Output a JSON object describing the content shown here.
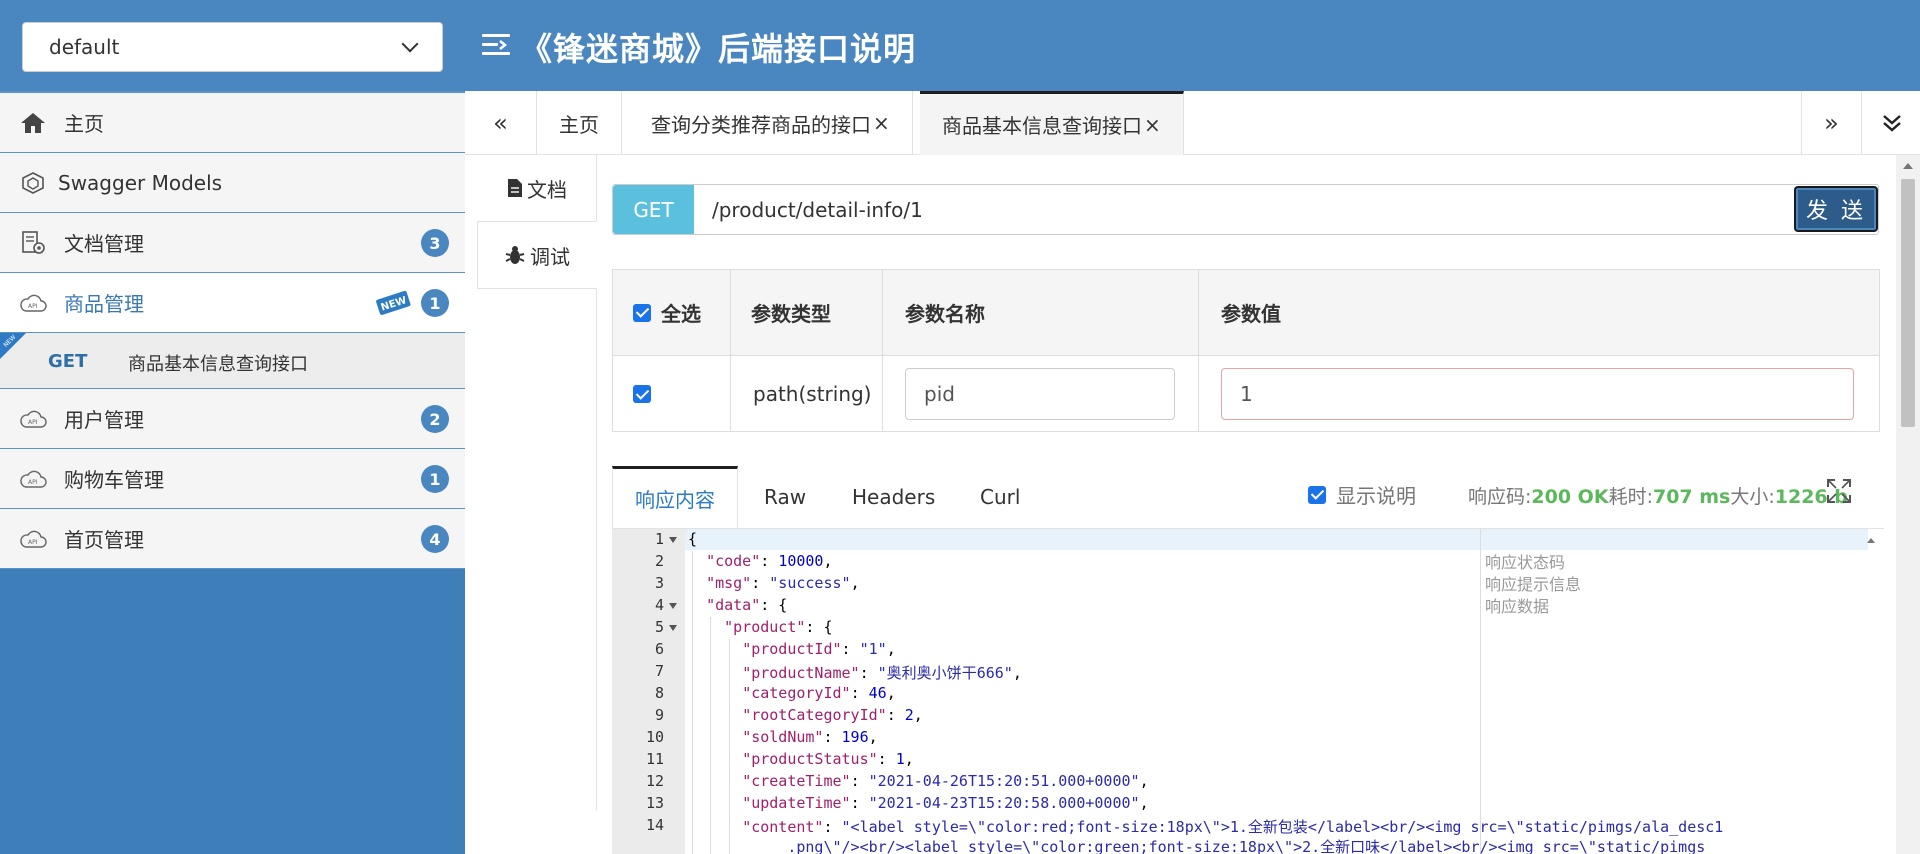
{
  "header": {
    "group_select": "default",
    "title": "《锋迷商城》后端接口说明"
  },
  "sidebar": {
    "items": [
      {
        "label": "主页",
        "icon": "home-icon",
        "badge": null
      },
      {
        "label": "Swagger Models",
        "icon": "swagger-icon",
        "badge": null
      },
      {
        "label": "文档管理",
        "icon": "doc-settings-icon",
        "badge": "3"
      },
      {
        "label": "商品管理",
        "icon": "api-cloud-icon",
        "badge": "1",
        "new_tag": "NEW",
        "active": true
      },
      {
        "label": "用户管理",
        "icon": "api-cloud-icon",
        "badge": "2"
      },
      {
        "label": "购物车管理",
        "icon": "api-cloud-icon",
        "badge": "1"
      },
      {
        "label": "首页管理",
        "icon": "api-cloud-icon",
        "badge": "4"
      }
    ],
    "sub_item": {
      "new_tag": "NEW",
      "method": "GET",
      "label": "商品基本信息查询接口"
    }
  },
  "tabs": {
    "items": [
      {
        "label": "主页",
        "closable": false
      },
      {
        "label": "查询分类推荐商品的接口",
        "closable": true
      },
      {
        "label": "商品基本信息查询接口",
        "closable": true,
        "active": true
      }
    ],
    "close_glyph": "×",
    "prev_glyph": "«",
    "next_glyph": "»",
    "more_glyph": "⌄"
  },
  "side_tabs": {
    "doc": "文档",
    "debug": "调试"
  },
  "request": {
    "method": "GET",
    "url": "/product/detail-info/1",
    "send": "发 送"
  },
  "params": {
    "headers": {
      "select_all": "全选",
      "type": "参数类型",
      "name": "参数名称",
      "value": "参数值"
    },
    "rows": [
      {
        "checked": true,
        "type": "path(string)",
        "name": "pid",
        "value": "1"
      }
    ]
  },
  "response": {
    "tabs": [
      "响应内容",
      "Raw",
      "Headers",
      "Curl"
    ],
    "show_desc": "显示说明",
    "code_label": "响应码:",
    "code_value": "200 OK",
    "time_label": "耗时:",
    "time_value": "707 ms",
    "size_label": "大小:",
    "size_value": "1226 b"
  },
  "editor": {
    "line_numbers": [
      "1",
      "2",
      "3",
      "4",
      "5",
      "6",
      "7",
      "8",
      "9",
      "10",
      "11",
      "12",
      "13",
      "14"
    ],
    "descriptions": [
      "响应状态码",
      "响应提示信息",
      "响应数据"
    ]
  },
  "colors": {
    "header_bg": "#4a87c0",
    "sidebar_bg": "#3f7fb9",
    "method_get": "#5bc0de",
    "send_btn": "#2d5b8a",
    "badge": "#4a87c0",
    "status_ok": "#5cb85c"
  }
}
